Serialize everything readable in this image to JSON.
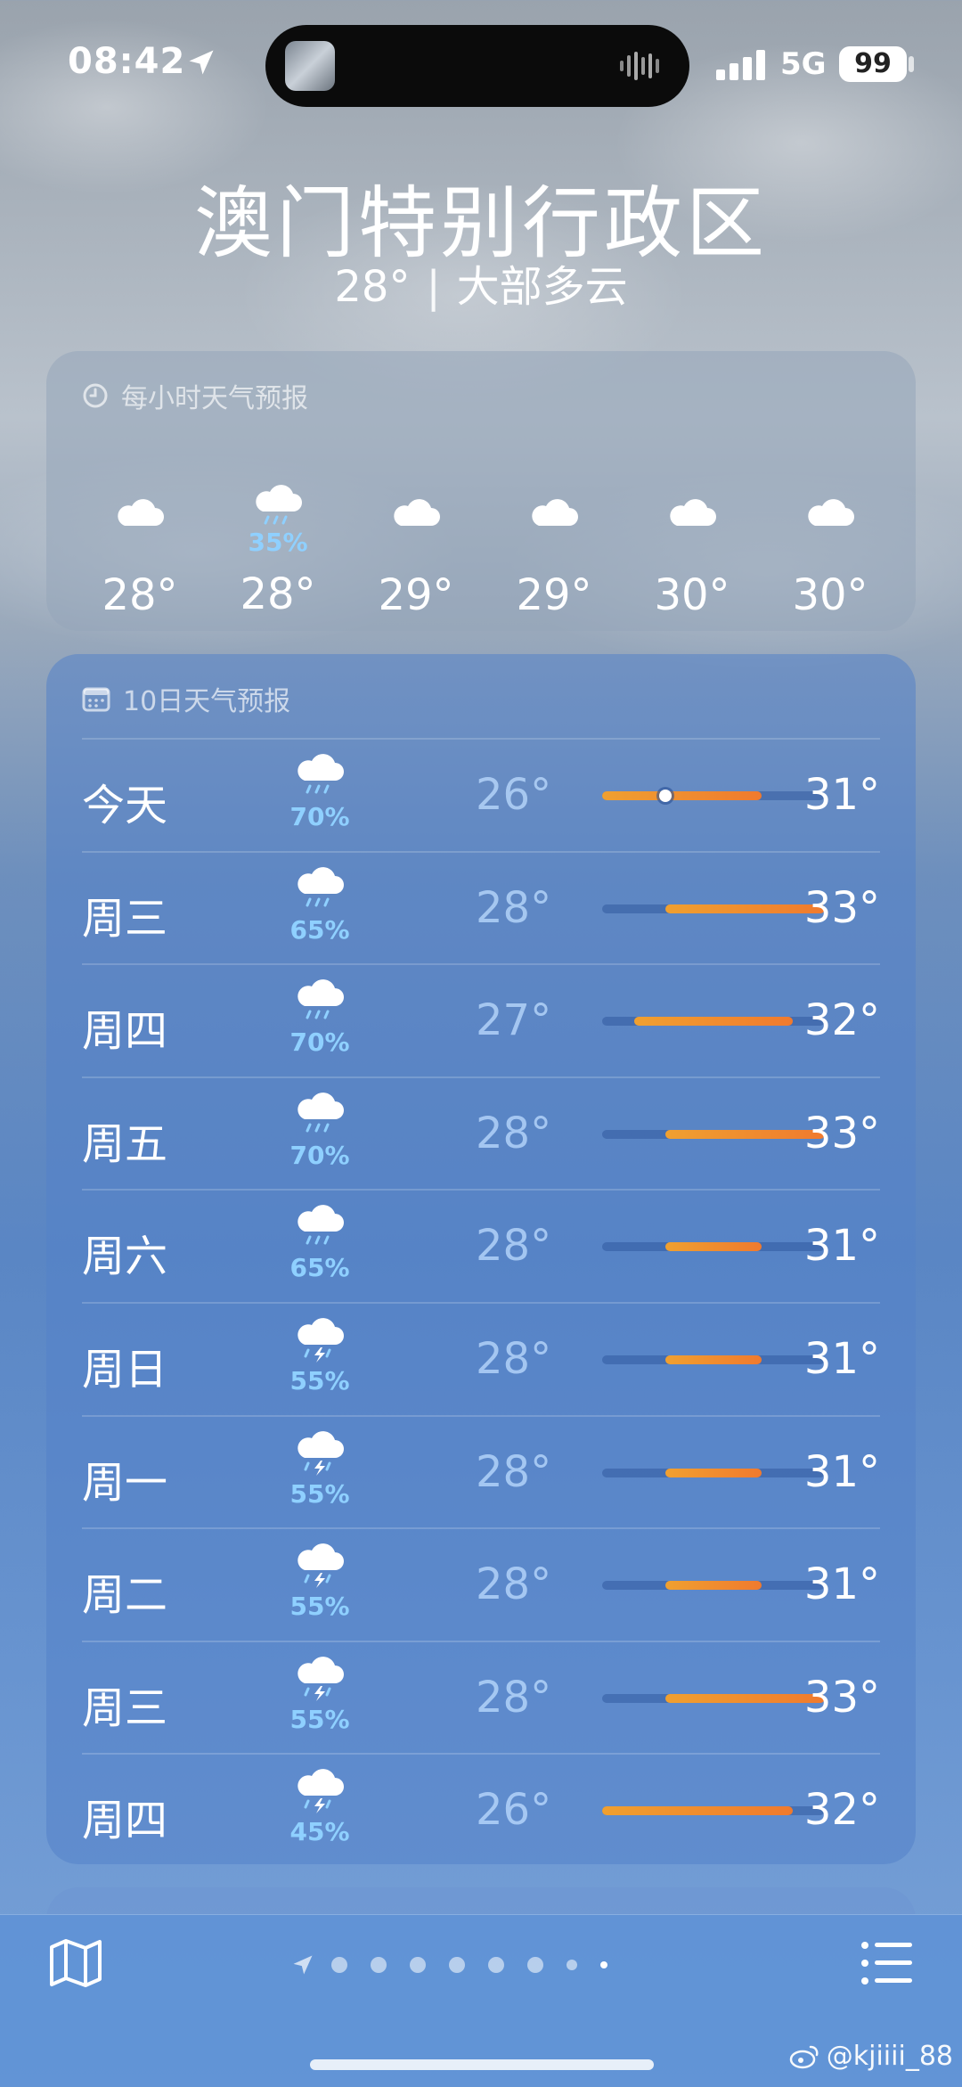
{
  "status_bar": {
    "time": "08:42",
    "network": "5G",
    "battery": "99"
  },
  "header": {
    "city": "澳门特别行政区",
    "current_temp": "28°",
    "separator": "|",
    "condition": "大部多云"
  },
  "hourly": {
    "title": "每小时天气预报",
    "items": [
      {
        "icon": "cloud-icon",
        "pop": "",
        "temp": "28°"
      },
      {
        "icon": "cloud-rain-icon",
        "pop": "35%",
        "temp": "28°"
      },
      {
        "icon": "cloud-icon",
        "pop": "",
        "temp": "29°"
      },
      {
        "icon": "cloud-icon",
        "pop": "",
        "temp": "29°"
      },
      {
        "icon": "cloud-icon",
        "pop": "",
        "temp": "30°"
      },
      {
        "icon": "cloud-icon",
        "pop": "",
        "temp": "30°"
      }
    ]
  },
  "ten_day": {
    "title": "10日天气预报",
    "range_min": 26,
    "range_max": 33,
    "current_temp": 28,
    "days": [
      {
        "name": "今天",
        "icon": "cloud-rain-icon",
        "pop": "70%",
        "low": "26°",
        "high": "31°",
        "low_v": 26,
        "high_v": 31,
        "today": true
      },
      {
        "name": "周三",
        "icon": "cloud-rain-icon",
        "pop": "65%",
        "low": "28°",
        "high": "33°",
        "low_v": 28,
        "high_v": 33
      },
      {
        "name": "周四",
        "icon": "cloud-rain-icon",
        "pop": "70%",
        "low": "27°",
        "high": "32°",
        "low_v": 27,
        "high_v": 32
      },
      {
        "name": "周五",
        "icon": "cloud-rain-icon",
        "pop": "70%",
        "low": "28°",
        "high": "33°",
        "low_v": 28,
        "high_v": 33
      },
      {
        "name": "周六",
        "icon": "cloud-rain-icon",
        "pop": "65%",
        "low": "28°",
        "high": "31°",
        "low_v": 28,
        "high_v": 31
      },
      {
        "name": "周日",
        "icon": "cloud-bolt-rain-icon",
        "pop": "55%",
        "low": "28°",
        "high": "31°",
        "low_v": 28,
        "high_v": 31
      },
      {
        "name": "周一",
        "icon": "cloud-bolt-rain-icon",
        "pop": "55%",
        "low": "28°",
        "high": "31°",
        "low_v": 28,
        "high_v": 31
      },
      {
        "name": "周二",
        "icon": "cloud-bolt-rain-icon",
        "pop": "55%",
        "low": "28°",
        "high": "31°",
        "low_v": 28,
        "high_v": 31
      },
      {
        "name": "周三",
        "icon": "cloud-bolt-rain-icon",
        "pop": "55%",
        "low": "28°",
        "high": "33°",
        "low_v": 28,
        "high_v": 33
      },
      {
        "name": "周四",
        "icon": "cloud-bolt-rain-icon",
        "pop": "45%",
        "low": "26°",
        "high": "32°",
        "low_v": 26,
        "high_v": 32
      }
    ]
  },
  "bottom_bar": {
    "page_count": 8
  },
  "watermark": "@kjiiii_88",
  "colors": {
    "accent_orange": "#f07a2e",
    "pop_blue": "#8fd0ff"
  }
}
